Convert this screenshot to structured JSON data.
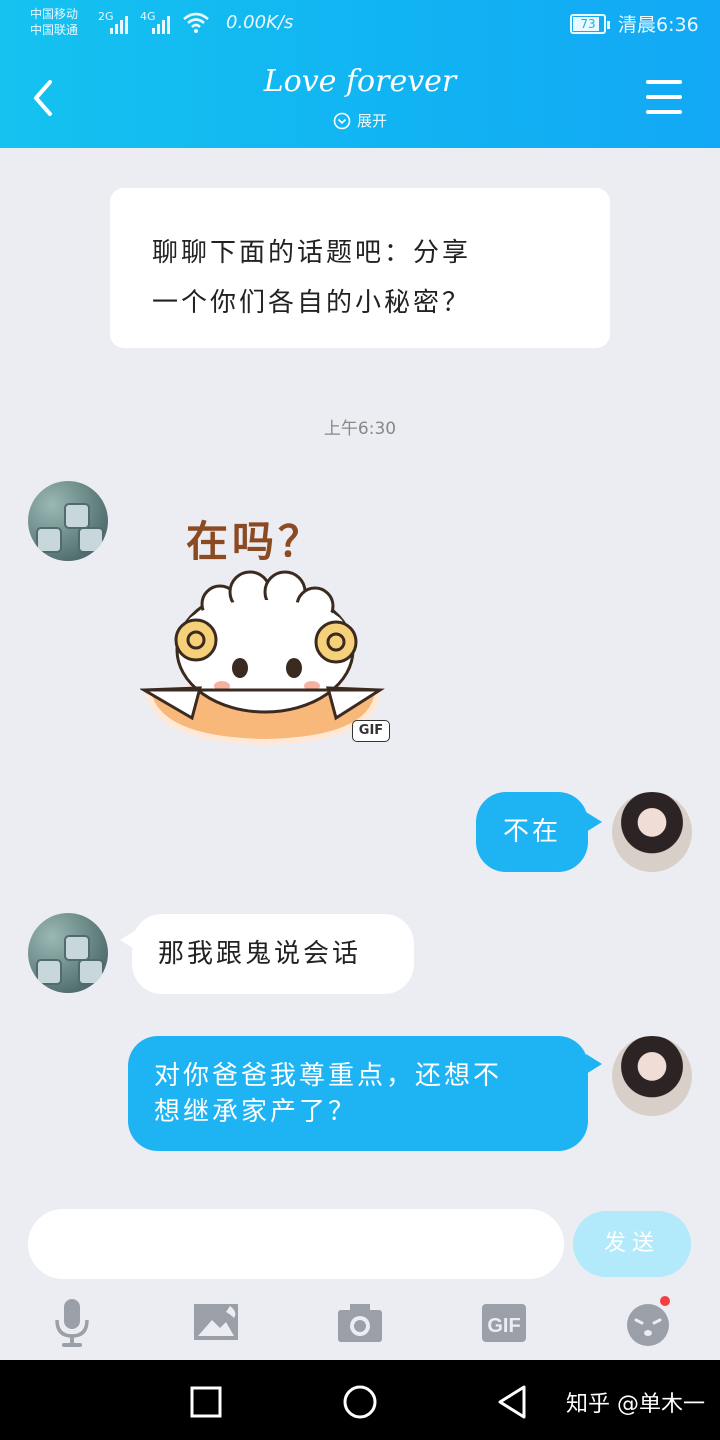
{
  "status_bar": {
    "carrier_line1": "中国移动",
    "carrier_line2": "中国联通",
    "sig1": "2G",
    "sig2": "4G",
    "speed": "0.00K/s",
    "battery": "73",
    "time": "清晨6:36"
  },
  "header": {
    "title": "Love forever",
    "subtitle": "展开"
  },
  "topic_card": {
    "line1": "聊聊下面的话题吧：分享",
    "line2": "一个你们各自的小秘密？"
  },
  "timestamp": "上午6:30",
  "sticker": {
    "text": "在吗？",
    "tag": "GIF"
  },
  "messages": [
    {
      "side": "right",
      "text": "不在"
    },
    {
      "side": "left",
      "text": "那我跟鬼说会话"
    },
    {
      "side": "right",
      "line1": "对你爸爸我尊重点，还想不",
      "line2": "想继承家产了？"
    }
  ],
  "composer": {
    "placeholder": "",
    "send_label": "发送"
  },
  "toolbar": {
    "gif_label": "GIF"
  },
  "navbar": {
    "watermark": "知乎 @单木一"
  },
  "colors": {
    "header_start": "#15c2f0",
    "header_end": "#12a8f5",
    "bubble_out": "#1eb3f3",
    "background": "#ebedf2",
    "send_button": "#b2eafb",
    "notify_dot": "#f24040"
  },
  "icons": [
    "back-arrow-icon",
    "menu-icon",
    "chevron-down-circle-icon",
    "microphone-icon",
    "image-icon",
    "camera-icon",
    "gif-icon",
    "emoji-icon",
    "square-nav-icon",
    "circle-nav-icon",
    "triangle-back-nav-icon"
  ]
}
